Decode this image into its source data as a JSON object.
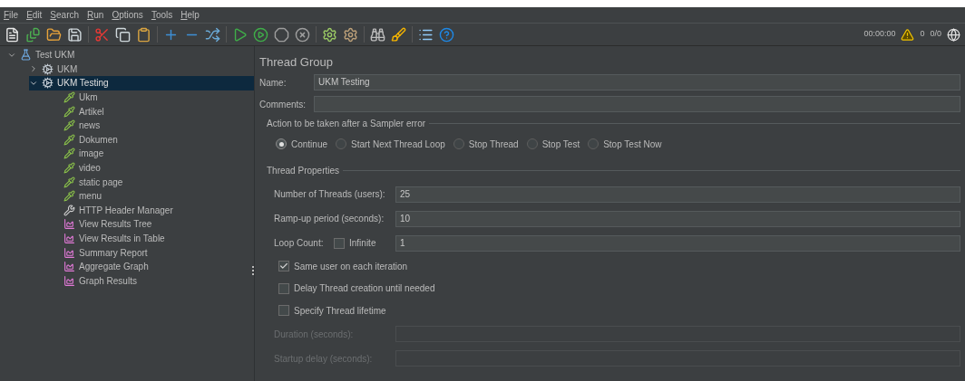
{
  "menu": [
    "File",
    "Edit",
    "Search",
    "Run",
    "Options",
    "Tools",
    "Help"
  ],
  "status": {
    "elapsed": "00:00:00",
    "warnings": "0",
    "threads": "0/0"
  },
  "tree": [
    {
      "label": "Test UKM",
      "kind": "plan",
      "expanded": true,
      "selected": false,
      "children": [
        {
          "label": "UKM",
          "kind": "group",
          "expanded": false,
          "selected": false
        },
        {
          "label": "UKM Testing",
          "kind": "group",
          "expanded": true,
          "selected": true,
          "children": [
            {
              "label": "Ukm",
              "kind": "sampler",
              "selected": false
            },
            {
              "label": "Artikel",
              "kind": "sampler",
              "selected": false
            },
            {
              "label": "news",
              "kind": "sampler",
              "selected": false
            },
            {
              "label": "Dokumen",
              "kind": "sampler",
              "selected": false
            },
            {
              "label": "image",
              "kind": "sampler",
              "selected": false
            },
            {
              "label": "video",
              "kind": "sampler",
              "selected": false
            },
            {
              "label": "static page",
              "kind": "sampler",
              "selected": false
            },
            {
              "label": "menu",
              "kind": "sampler",
              "selected": false
            },
            {
              "label": "HTTP Header Manager",
              "kind": "config",
              "selected": false
            },
            {
              "label": "View Results Tree",
              "kind": "listener",
              "selected": false
            },
            {
              "label": "View Results in Table",
              "kind": "listener",
              "selected": false
            },
            {
              "label": "Summary Report",
              "kind": "listener",
              "selected": false
            },
            {
              "label": "Aggregate Graph",
              "kind": "listener",
              "selected": false
            },
            {
              "label": "Graph Results",
              "kind": "listener",
              "selected": false
            }
          ]
        }
      ]
    }
  ],
  "panel": {
    "title": "Thread Group",
    "name": {
      "label": "Name:",
      "value": "UKM Testing"
    },
    "comments": {
      "label": "Comments:"
    },
    "error_action": {
      "legend": "Action to be taken after a Sampler error",
      "options": [
        {
          "label": "Continue",
          "selected": true
        },
        {
          "label": "Start Next Thread Loop",
          "selected": false
        },
        {
          "label": "Stop Thread",
          "selected": false
        },
        {
          "label": "Stop Test",
          "selected": false
        },
        {
          "label": "Stop Test Now",
          "selected": false
        }
      ]
    },
    "properties": {
      "legend": "Thread Properties",
      "threads": {
        "label": "Number of Threads (users):",
        "value": "25"
      },
      "rampup": {
        "label": "Ramp-up period (seconds):",
        "value": "10"
      },
      "loop": {
        "label": "Loop Count:",
        "infinite": {
          "label": "Infinite",
          "checked": false
        },
        "value": "1"
      },
      "checks": [
        {
          "label": "Same user on each iteration",
          "checked": true
        },
        {
          "label": "Delay Thread creation until needed",
          "checked": false
        },
        {
          "label": "Specify Thread lifetime",
          "checked": false
        }
      ],
      "duration": {
        "label": "Duration (seconds):",
        "disabled": true
      },
      "startup": {
        "label": "Startup delay (seconds):",
        "disabled": true
      }
    }
  }
}
